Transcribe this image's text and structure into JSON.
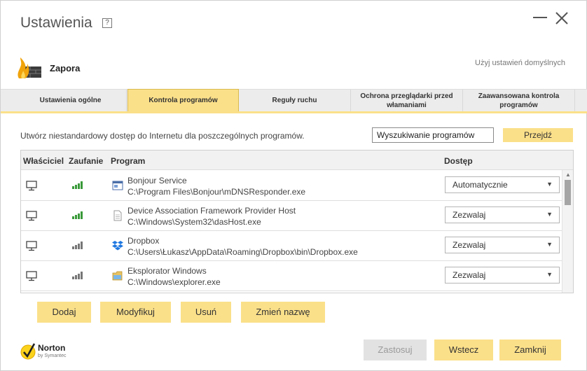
{
  "window": {
    "title": "Ustawienia",
    "help_label": "?"
  },
  "section": {
    "title": "Zapora",
    "defaults_link": "Użyj ustawień domyślnych"
  },
  "tabs": [
    {
      "label": "Ustawienia ogólne",
      "active": false
    },
    {
      "label": "Kontrola programów",
      "active": true
    },
    {
      "label": "Reguły ruchu",
      "active": false
    },
    {
      "label": "Ochrona przeglądarki przed włamaniami",
      "active": false
    },
    {
      "label": "Zaawansowana kontrola programów",
      "active": false
    }
  ],
  "intro_text": "Utwórz niestandardowy dostęp do Internetu dla poszczególnych programów.",
  "search": {
    "value": "Wyszukiwanie programów",
    "go_label": "Przejdź"
  },
  "table": {
    "headers": {
      "owner": "Właściciel",
      "trust": "Zaufanie",
      "program": "Program",
      "access": "Dostęp"
    },
    "rows": [
      {
        "name": "Bonjour Service",
        "path": "C:\\Program Files\\Bonjour\\mDNSResponder.exe",
        "access": "Automatycznie",
        "trust_level": 3,
        "trust_color": "#3a9a3a",
        "owner_icon": "monitor-icon",
        "app_icon": "service-window-icon"
      },
      {
        "name": "Device Association Framework Provider Host",
        "path": "C:\\Windows\\System32\\dasHost.exe",
        "access": "Zezwalaj",
        "trust_level": 3,
        "trust_color": "#3a9a3a",
        "owner_icon": "monitor-icon",
        "app_icon": "document-icon"
      },
      {
        "name": "Dropbox",
        "path": "C:\\Users\\Łukasz\\AppData\\Roaming\\Dropbox\\bin\\Dropbox.exe",
        "access": "Zezwalaj",
        "trust_level": 3,
        "trust_color": "#777777",
        "owner_icon": "monitor-icon",
        "app_icon": "dropbox-icon"
      },
      {
        "name": "Eksplorator Windows",
        "path": "C:\\Windows\\explorer.exe",
        "access": "Zezwalaj",
        "trust_level": 3,
        "trust_color": "#777777",
        "owner_icon": "monitor-icon",
        "app_icon": "folder-icon"
      }
    ]
  },
  "actions": {
    "add": "Dodaj",
    "modify": "Modyfikuj",
    "remove": "Usuń",
    "rename": "Zmień nazwę"
  },
  "footer": {
    "brand_name": "Norton",
    "brand_sub": "by Symantec",
    "apply": "Zastosuj",
    "back": "Wstecz",
    "close": "Zamknij"
  },
  "colors": {
    "accent": "#fbe08a",
    "trust_high": "#3a9a3a",
    "trust_unknown": "#777777"
  }
}
